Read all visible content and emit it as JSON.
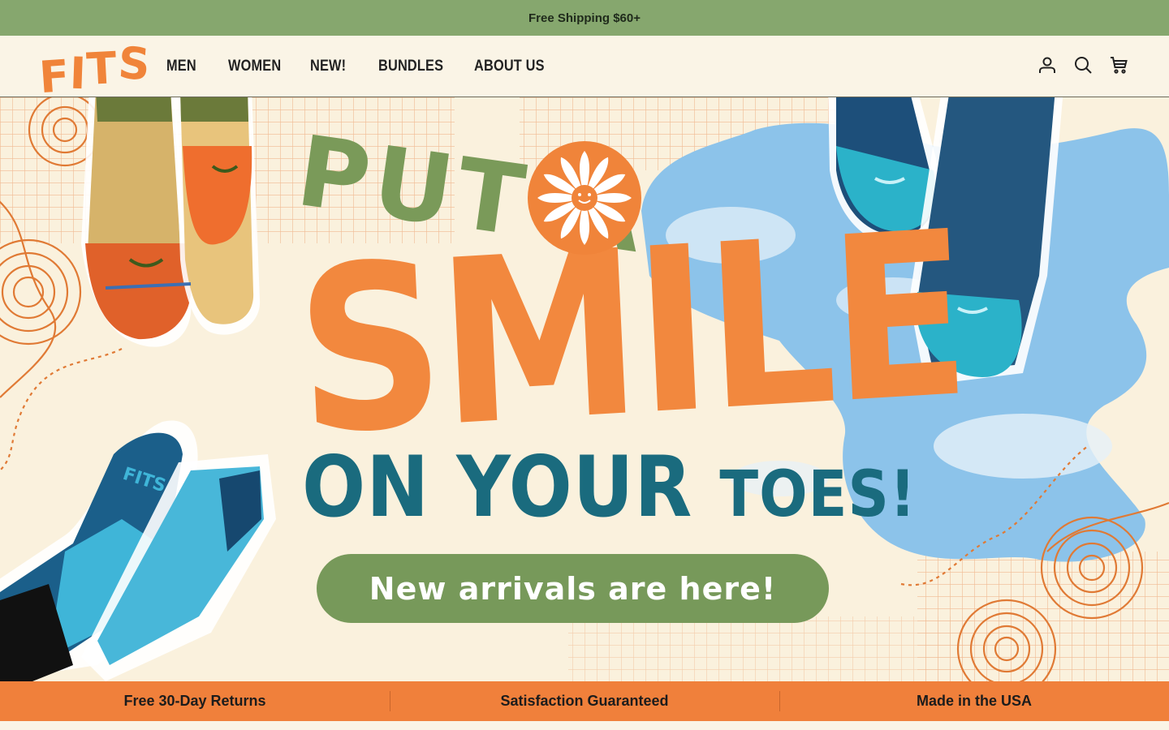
{
  "announcement": {
    "text": "Free Shipping $60+"
  },
  "header": {
    "logo": [
      "F",
      "I",
      "T",
      "S"
    ],
    "nav": [
      {
        "label": "MEN"
      },
      {
        "label": "WOMEN"
      },
      {
        "label": "NEW!"
      },
      {
        "label": "BUNDLES"
      },
      {
        "label": "ABOUT US"
      }
    ],
    "icons": [
      "account-icon",
      "search-icon",
      "cart-icon"
    ]
  },
  "hero": {
    "line1": "PUT A",
    "line2": "SMILE",
    "line3a": "ON YOUR",
    "line3b": "TOES!",
    "cta": "New arrivals are here!",
    "sock_brand_text": "FITS"
  },
  "benefits": [
    {
      "label": "Free 30-Day Returns"
    },
    {
      "label": "Satisfaction Guaranteed"
    },
    {
      "label": "Made in the USA"
    }
  ],
  "colors": {
    "announcement_bg": "#86a76e",
    "brand_orange": "#f0843a",
    "green": "#77995a",
    "teal": "#1a6b7e",
    "cream": "#faf4e6"
  }
}
